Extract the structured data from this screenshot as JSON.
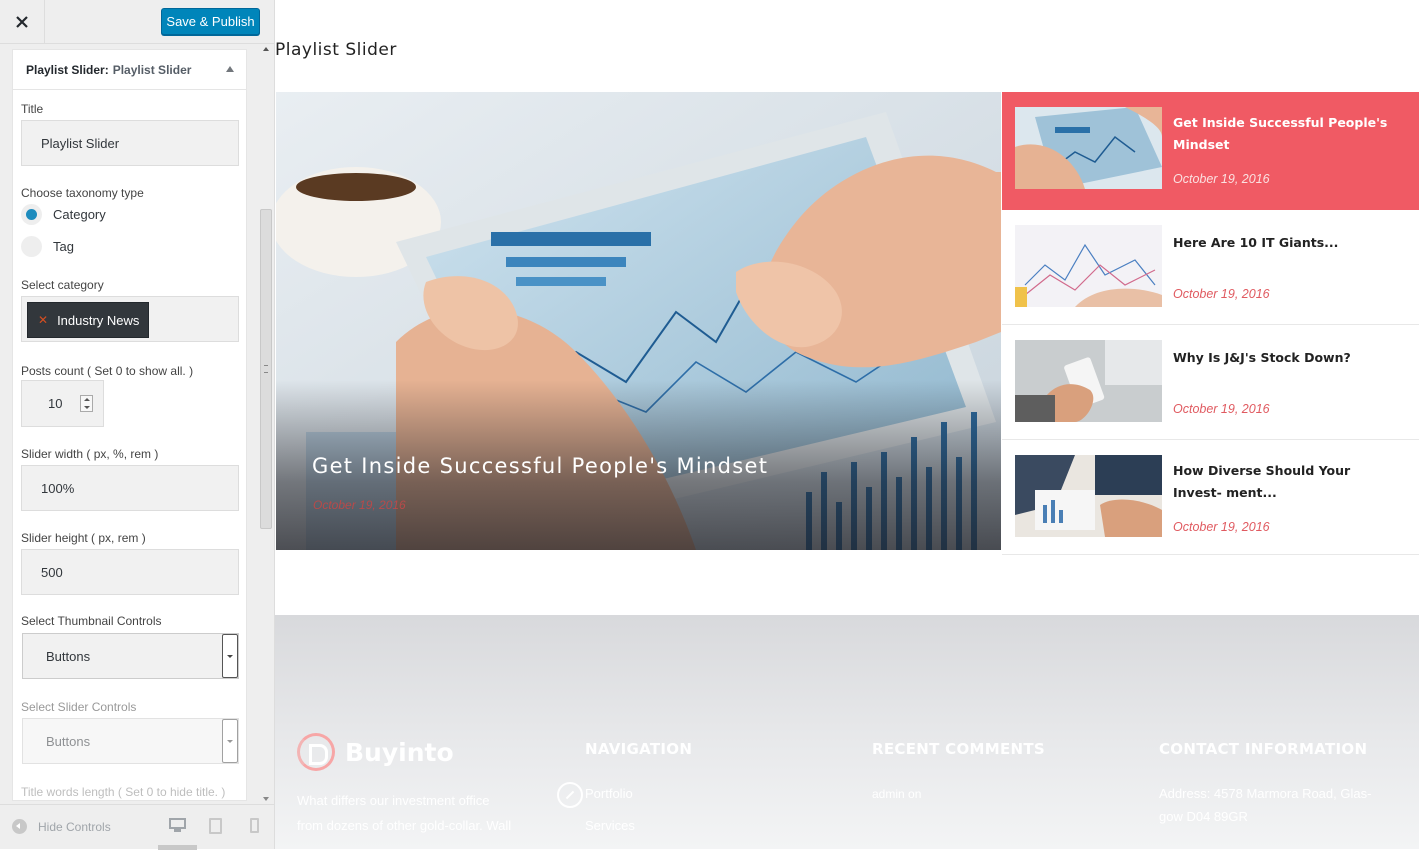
{
  "toolbar": {
    "save_label": "Save & Publish"
  },
  "widget": {
    "header_prefix": "Playlist Slider:",
    "header_name": "Playlist Slider",
    "fields": {
      "title_label": "Title",
      "title_value": "Playlist Slider",
      "taxonomy_label": "Choose taxonomy type",
      "taxonomy_options": [
        "Category",
        "Tag"
      ],
      "taxonomy_selected": "Category",
      "category_label": "Select category",
      "category_tag": "Industry News",
      "posts_count_label": "Posts count ( Set 0 to show all. )",
      "posts_count_value": "10",
      "slider_width_label": "Slider width ( px, %, rem )",
      "slider_width_value": "100%",
      "slider_height_label": "Slider height ( px, rem )",
      "slider_height_value": "500",
      "thumb_controls_label": "Select Thumbnail Controls",
      "thumb_controls_value": "Buttons",
      "slider_controls_label": "Select Slider Controls",
      "slider_controls_value": "Buttons",
      "title_words_label": "Title words length ( Set 0 to hide title. )"
    }
  },
  "footer_controls": {
    "hide_label": "Hide Controls"
  },
  "preview": {
    "widget_title": "Playlist Slider",
    "main_slide": {
      "title": "Get Inside Successful People's Mindset",
      "date": "October 19, 2016"
    },
    "playlist": [
      {
        "title": "Get Inside Successful People's Mindset",
        "date": "October 19, 2016",
        "active": true
      },
      {
        "title": "Here Are 10 IT Giants...",
        "date": "October 19, 2016",
        "active": false
      },
      {
        "title": "Why Is J&J's Stock Down?",
        "date": "October 19, 2016",
        "active": false
      },
      {
        "title": "How Diverse Should Your Invest- ment...",
        "date": "October 19, 2016",
        "active": false
      }
    ],
    "footer": {
      "brand": "Buyinto",
      "brand_text_1": "What differs our investment office",
      "brand_text_2": "from dozens of other gold-collar. Wall",
      "nav_heading": "NAVIGATION",
      "nav_items": [
        "Portfolio",
        "Services"
      ],
      "comments_heading": "RECENT COMMENTS",
      "comments_text": "admin on",
      "contact_heading": "CONTACT INFORMATION",
      "contact_line_1": "Address: 4578 Marmora Road, Glas-",
      "contact_line_2": "gow D04 89GR"
    }
  },
  "colors": {
    "accent": "#0085ba",
    "playlist_active": "#f05a64",
    "date_color": "#e05a60"
  },
  "icons": [
    "close-icon",
    "triangle-up-icon",
    "remove-x-icon",
    "spinner-icon",
    "dropdown-arrow-icon",
    "hide-controls-icon",
    "desktop-icon",
    "tablet-icon",
    "mobile-icon",
    "buyinto-logo-icon",
    "edit-pencil-icon"
  ]
}
